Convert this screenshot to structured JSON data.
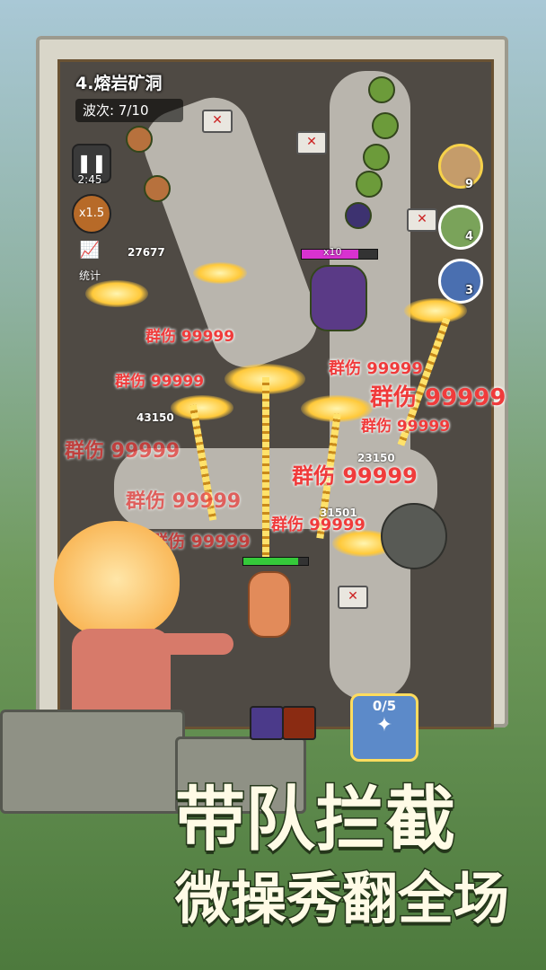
{
  "stage": {
    "title": "4.熔岩矿洞",
    "wave": "波次: 7/10"
  },
  "controls": {
    "pause_time": "2:45",
    "speed": "x1.5",
    "stats_label": "统计"
  },
  "heroes": [
    {
      "name": "hero-portrait-1",
      "count": "9"
    },
    {
      "name": "hero-portrait-2",
      "count": "4"
    },
    {
      "name": "hero-portrait-3",
      "count": "3"
    }
  ],
  "boss": {
    "multiplier": "x10",
    "hp_fraction": 0.75
  },
  "hero_hp_fraction": 0.85,
  "damage_texts": [
    "群伤 99999",
    "群伤 99999",
    "群伤 99999",
    "群伤 99999",
    "群伤 99999",
    "群伤 99999",
    "群伤 99999",
    "群伤 99999",
    "群伤 99999",
    "群伤 99999"
  ],
  "hp_numbers": [
    "27677",
    "43150",
    "23150",
    "31501"
  ],
  "card_counter": "0/5",
  "slogan": {
    "line1": "带队拦截",
    "line2": "微操秀翻全场"
  },
  "colors": {
    "damage": "#f03b3b",
    "accent": "#ffc93a",
    "boss_bar": "#d832d0",
    "hero_bar": "#35c93a"
  }
}
